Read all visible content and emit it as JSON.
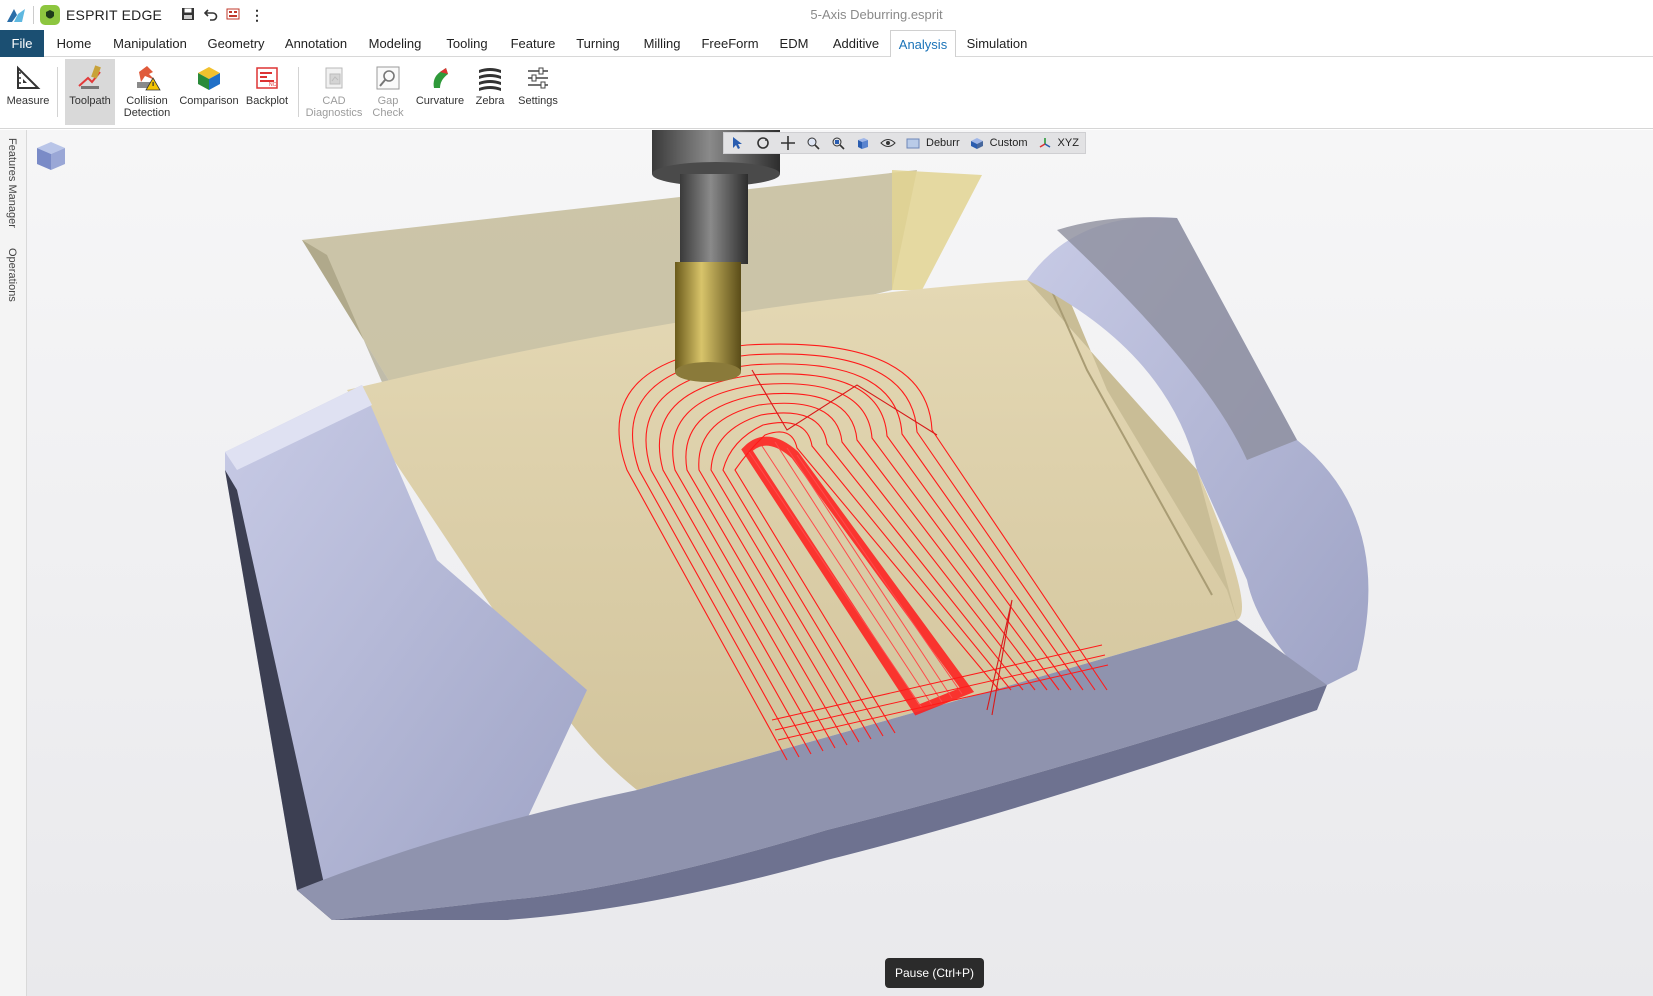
{
  "titlebar": {
    "app_name": "ESPRIT EDGE",
    "document_title": "5-Axis Deburring.esprit",
    "quick_access": {
      "save_icon": "save-icon",
      "undo_icon": "undo-icon",
      "report_icon": "report-icon",
      "more_label": "⋮"
    }
  },
  "menu": {
    "tabs": [
      "File",
      "Home",
      "Manipulation",
      "Geometry",
      "Annotation",
      "Modeling",
      "Tooling",
      "Feature",
      "Turning",
      "Milling",
      "FreeForm",
      "EDM",
      "Additive",
      "Analysis",
      "Simulation"
    ],
    "active": "Analysis"
  },
  "ribbon": {
    "buttons": [
      {
        "label": "Measure",
        "icon": "measure-icon"
      },
      {
        "label": "Toolpath",
        "icon": "toolpath-icon",
        "selected": true
      },
      {
        "label_1": "Collision",
        "label_2": "Detection",
        "icon": "collision-detection-icon"
      },
      {
        "label": "Comparison",
        "icon": "comparison-icon"
      },
      {
        "label": "Backplot",
        "icon": "backplot-icon"
      },
      {
        "label_1": "CAD",
        "label_2": "Diagnostics",
        "icon": "cad-diagnostics-icon",
        "disabled": true
      },
      {
        "label_1": "Gap",
        "label_2": "Check",
        "icon": "gap-check-icon",
        "disabled": true
      },
      {
        "label": "Curvature",
        "icon": "curvature-icon"
      },
      {
        "label": "Zebra",
        "icon": "zebra-icon"
      },
      {
        "label": "Settings",
        "icon": "settings-icon"
      }
    ]
  },
  "side_panel": {
    "tabs": [
      "Features Manager",
      "Operations"
    ]
  },
  "view_toolbar": {
    "icons": [
      "select-icon",
      "rotate-icon",
      "pan-icon",
      "zoom-window-icon",
      "zoom-fit-icon",
      "view-cube-icon",
      "visibility-icon"
    ],
    "deburr_label": "Deburr",
    "custom_label": "Custom",
    "xyz_label": "XYZ"
  },
  "tooltip": {
    "text": "Pause (Ctrl+P)"
  },
  "colors": {
    "file_tab": "#1b4f72",
    "active_tab_text": "#1a73b8",
    "toolpath": "#ff1a1a",
    "part_face": "#d8cca6",
    "fixture": "#aeb3cf"
  }
}
